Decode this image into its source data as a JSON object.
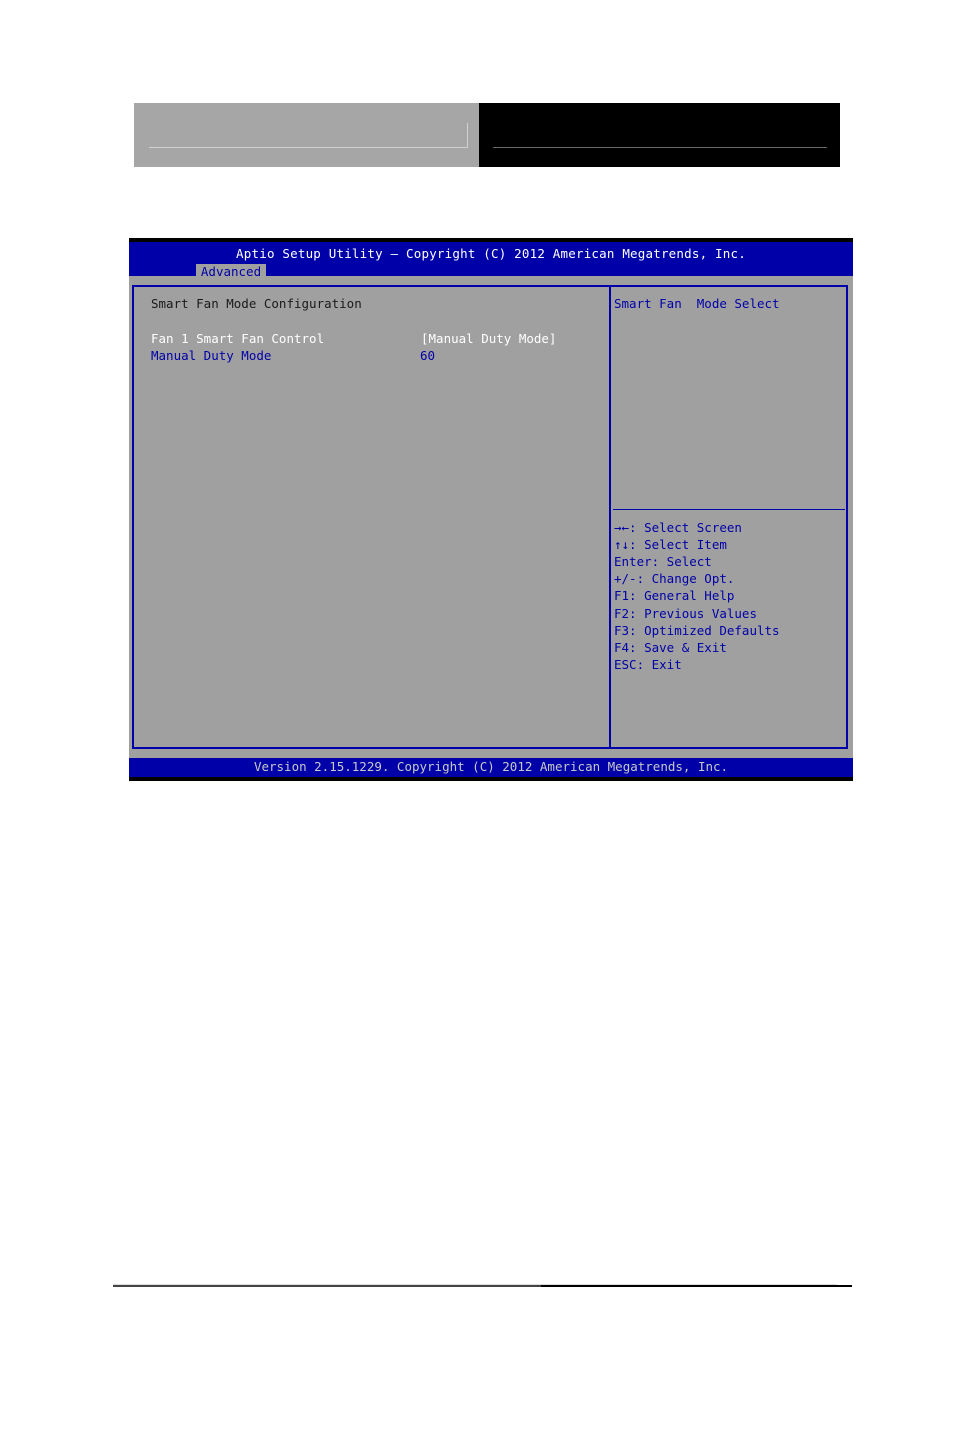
{
  "bios": {
    "title": "Aptio Setup Utility – Copyright (C) 2012 American Megatrends, Inc.",
    "active_tab": "Advanced",
    "section_heading": "Smart Fan Mode Configuration",
    "settings": [
      {
        "label": "Fan 1 Smart Fan Control",
        "value": "[Manual Duty Mode]",
        "selected": true
      },
      {
        "label": "Manual Duty Mode",
        "value": "60",
        "selected": false
      }
    ],
    "help_text": "Smart Fan  Mode Select",
    "key_help": [
      "→←: Select Screen",
      "↑↓: Select Item",
      "Enter: Select",
      "+/-: Change Opt.",
      "F1: General Help",
      "F2: Previous Values",
      "F3: Optimized Defaults",
      "F4: Save & Exit",
      "ESC: Exit"
    ],
    "footer": "Version 2.15.1229. Copyright (C) 2012 American Megatrends, Inc."
  },
  "colors": {
    "bios_blue": "#0000a8",
    "bios_gray": "#a0a0a0",
    "selected_text": "#ffffff",
    "normal_text": "#0000a8"
  }
}
